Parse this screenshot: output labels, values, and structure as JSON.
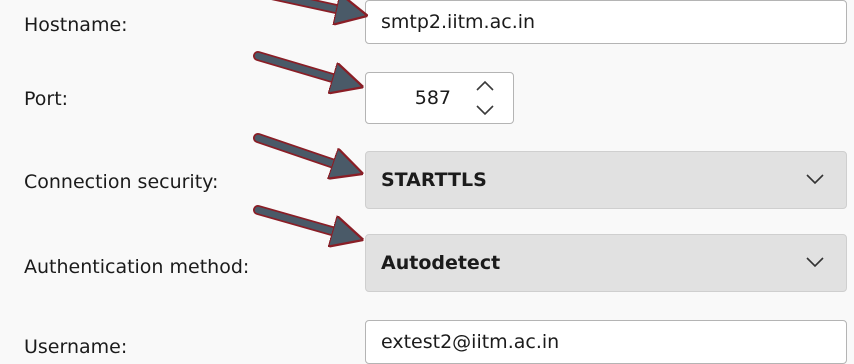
{
  "form": {
    "hostname": {
      "label": "Hostname:",
      "value": "smtp2.iitm.ac.in"
    },
    "port": {
      "label": "Port:",
      "value": "587"
    },
    "connection_security": {
      "label": "Connection security:",
      "value": "STARTTLS"
    },
    "authentication_method": {
      "label": "Authentication method:",
      "value": "Autodetect"
    },
    "username": {
      "label": "Username:",
      "value": "extest2@iitm.ac.in"
    }
  },
  "icons": {
    "spin_up": "chevron-up-icon",
    "spin_down": "chevron-down-icon",
    "dropdown": "chevron-down-icon",
    "annotation": "arrow-pointer-icon"
  },
  "colors": {
    "arrow_fill": "#4a5a68",
    "arrow_outline": "#8a1e26",
    "select_bg": "#e1e1e1",
    "page_bg": "#f9f9f9"
  }
}
